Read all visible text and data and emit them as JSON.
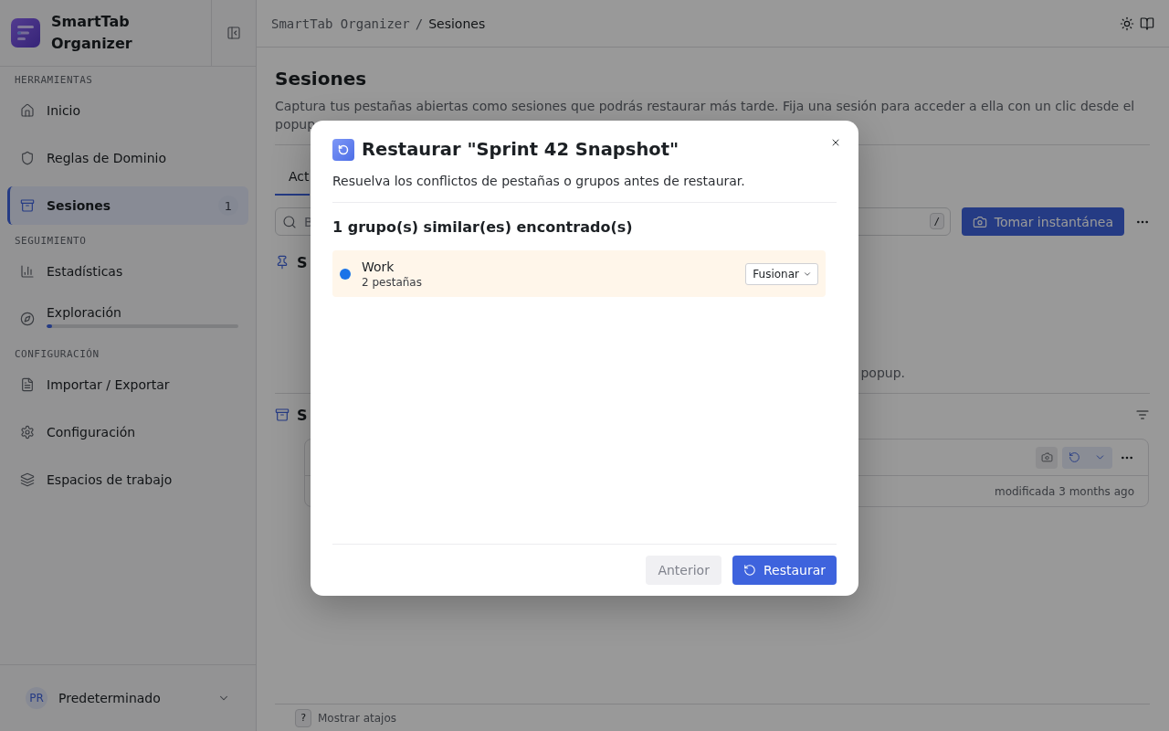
{
  "sidebar": {
    "app_name": "SmartTab Organizer",
    "sections": [
      {
        "heading": "HERRAMIENTAS",
        "items": [
          {
            "label": "Inicio",
            "kind": "link",
            "selected": false
          },
          {
            "label": "Reglas de Dominio",
            "kind": "link",
            "selected": false
          },
          {
            "label": "Sesiones",
            "kind": "link",
            "selected": true,
            "badge": "1"
          }
        ]
      },
      {
        "heading": "SEGUIMIENTO",
        "items": [
          {
            "label": "Estadísticas",
            "kind": "link",
            "selected": false
          },
          {
            "label": "Exploración",
            "kind": "progress",
            "selected": false,
            "level": 0.03
          }
        ]
      },
      {
        "heading": "CONFIGURACIÓN",
        "items": [
          {
            "label": "Importar / Exportar",
            "kind": "link",
            "selected": false
          },
          {
            "label": "Configuración",
            "kind": "link",
            "selected": false
          },
          {
            "label": "Espacios de trabajo",
            "kind": "link",
            "selected": false
          }
        ]
      }
    ],
    "profile": {
      "initials": "PR",
      "name": "Predeterminado"
    }
  },
  "header": {
    "breadcrumb": [
      "SmartTab Organizer",
      "Sesiones"
    ],
    "separator": "/"
  },
  "page": {
    "title": "Sesiones",
    "description": "Captura tus pestañas abiertas como sesiones que podrás restaurar más tarde. Fija una sesión para acceder a ella con un clic desde el popup",
    "tabs": [
      {
        "label": "Act",
        "selected": true
      }
    ],
    "search": {
      "placeholder": "B",
      "shortcut": "/"
    },
    "snapshot_button": "Tomar instantánea",
    "pinned_section": {
      "title": "S",
      "empty_message": "popup."
    },
    "saved_section": {
      "title": "S",
      "sessions": [
        {
          "modified": "modificada 3 months ago"
        }
      ]
    }
  },
  "footer": {
    "shortcut_key": "?",
    "label": "Mostrar atajos"
  },
  "dialog": {
    "title": "Restaurar \"Sprint 42 Snapshot\"",
    "subtitle": "Resuelva los conflictos de pestañas o grupos antes de restaurar.",
    "conflicts_heading": "1 grupo(s) similar(es) encontrado(s)",
    "groups": [
      {
        "name": "Work",
        "tab_count": "2 pestañas",
        "color": "#1a73e8",
        "action": "Fusionar"
      }
    ],
    "buttons": [
      {
        "label": "Anterior",
        "kind": "secondary"
      },
      {
        "label": "Restaurar",
        "kind": "primary"
      }
    ]
  }
}
